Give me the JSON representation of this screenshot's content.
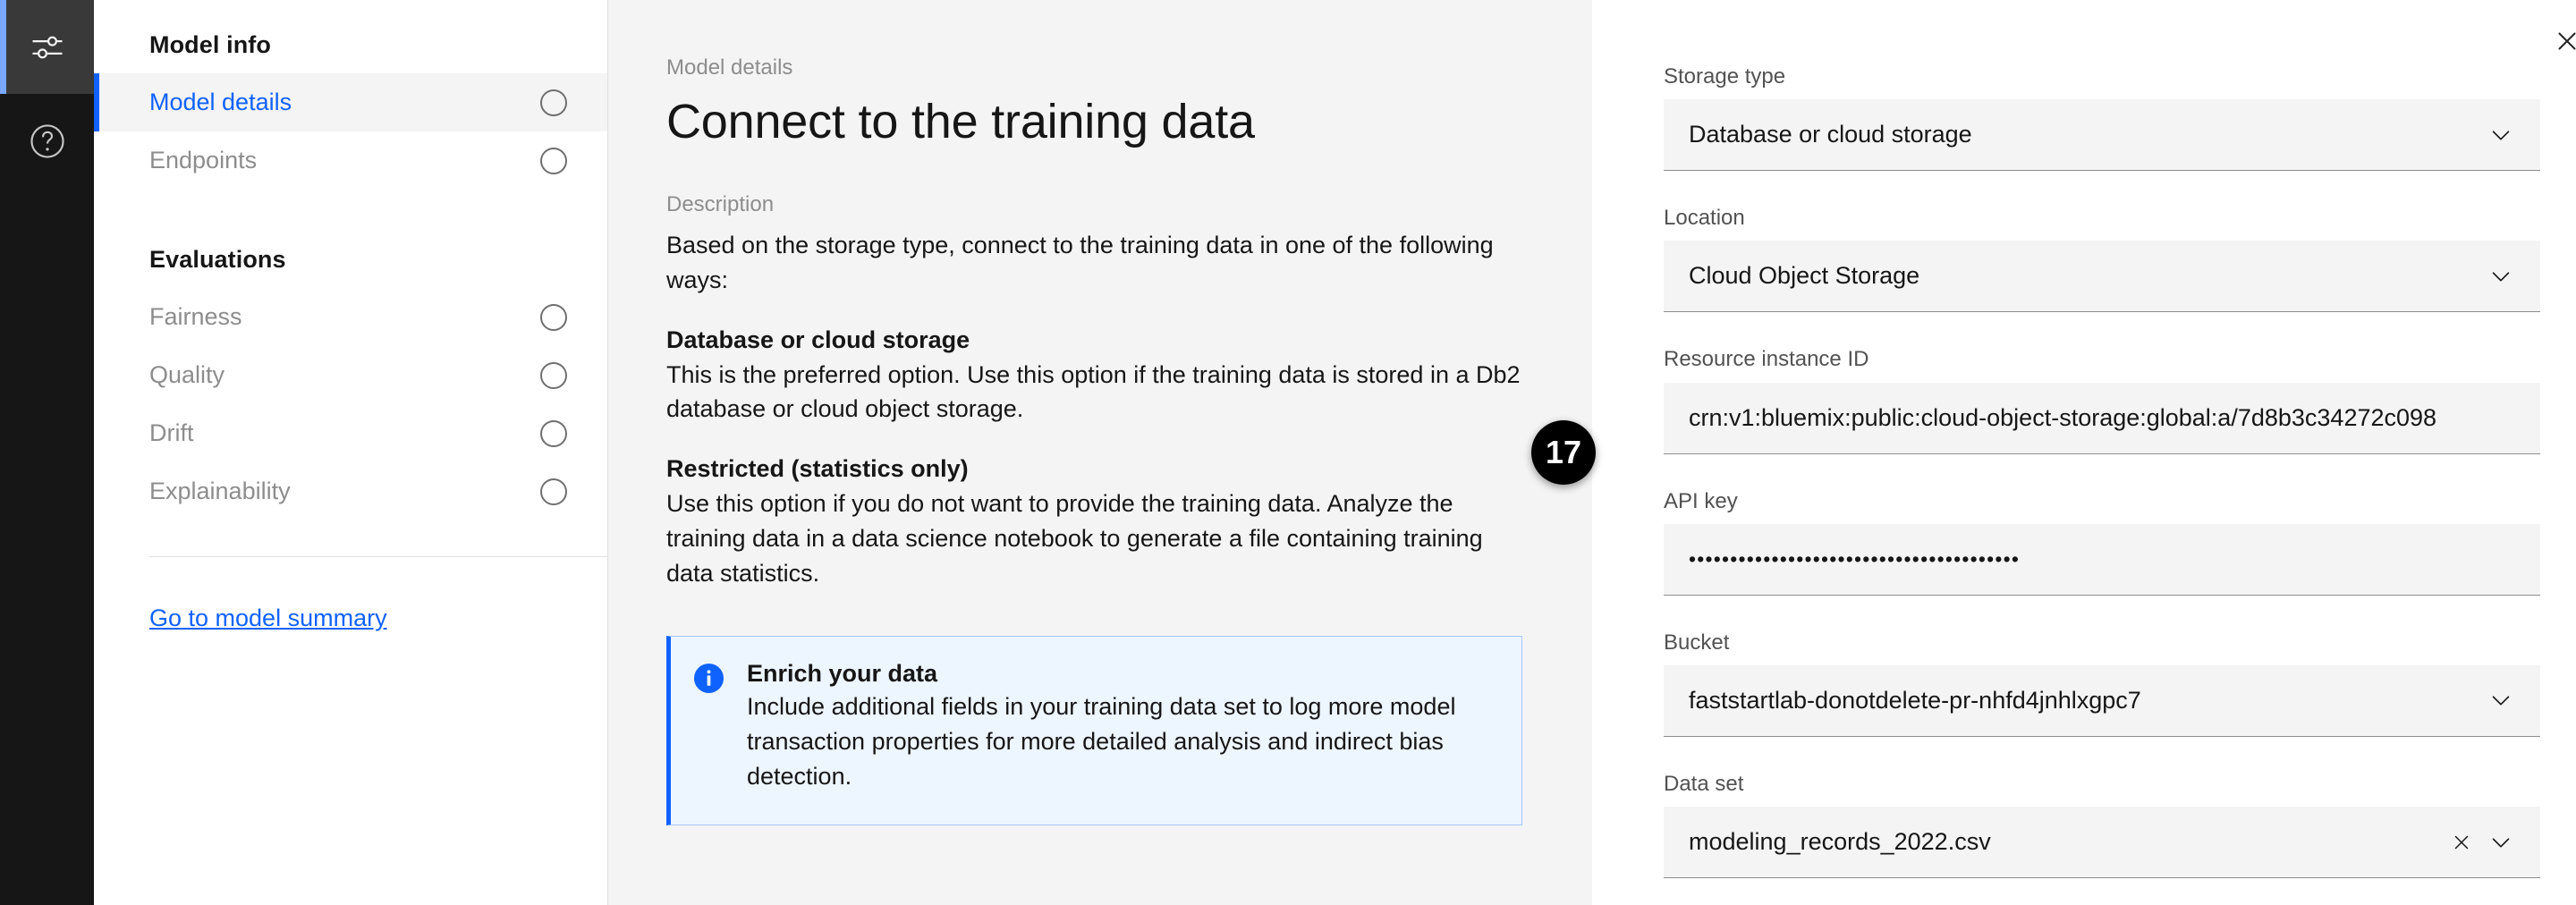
{
  "rail": {
    "items": [
      {
        "icon": "sliders-icon",
        "active": true
      },
      {
        "icon": "help-circle-icon",
        "active": false
      }
    ]
  },
  "sidebar": {
    "sections": [
      {
        "title": "Model info",
        "items": [
          {
            "label": "Model details",
            "active": true,
            "indicator": "circle"
          },
          {
            "label": "Endpoints",
            "active": false,
            "indicator": "circle"
          }
        ]
      },
      {
        "title": "Evaluations",
        "items": [
          {
            "label": "Fairness",
            "active": false,
            "indicator": "circle"
          },
          {
            "label": "Quality",
            "active": false,
            "indicator": "circle"
          },
          {
            "label": "Drift",
            "active": false,
            "indicator": "circle"
          },
          {
            "label": "Explainability",
            "active": false,
            "indicator": "circle"
          }
        ]
      }
    ],
    "summary_link": "Go to model summary"
  },
  "main": {
    "breadcrumb": "Model details",
    "title": "Connect to the training data",
    "description_label": "Description",
    "intro": "Based on the storage type, connect to the training data in one of the following ways:",
    "sections": [
      {
        "heading": "Database or cloud storage",
        "body": "This is the preferred option. Use this option if the training data is stored in a Db2 database or cloud object storage."
      },
      {
        "heading": "Restricted (statistics only)",
        "body": "Use this option if you do not want to provide the training data. Analyze the training data in a data science notebook to generate a file containing training data statistics."
      }
    ],
    "notification": {
      "icon": "info-filled-icon",
      "title": "Enrich your data",
      "body": "Include additional fields in your training data set to log more model transaction properties for more detailed analysis and indirect bias detection."
    }
  },
  "panel": {
    "close_icon": "close-icon",
    "fields": [
      {
        "label": "Storage type",
        "value": "Database or cloud storage",
        "type": "select",
        "has_clear": false,
        "has_refresh": false
      },
      {
        "label": "Location",
        "value": "Cloud Object Storage",
        "type": "select",
        "has_clear": false,
        "has_refresh": false
      },
      {
        "label": "Resource instance ID",
        "value": "crn:v1:bluemix:public:cloud-object-storage:global:a/7d8b3c34272c098",
        "type": "text",
        "has_clear": false,
        "has_refresh": false
      },
      {
        "label": "API key",
        "value": "••••••••••••••••••••••••••••••••••••••••",
        "type": "password",
        "has_clear": false,
        "has_refresh": false
      },
      {
        "label": "Bucket",
        "value": "faststartlab-donotdelete-pr-nhfd4jnhlxgpc7",
        "type": "select",
        "has_clear": false,
        "has_refresh": true
      },
      {
        "label": "Data set",
        "value": "modeling_records_2022.csv",
        "type": "select",
        "has_clear": true,
        "has_refresh": true
      }
    ]
  },
  "step_badge": {
    "number": "17"
  },
  "colors": {
    "accent": "#0f62fe",
    "rail_bg": "#161616",
    "rail_active_bg": "#393939",
    "rail_active_bar": "#78a9ff",
    "main_bg": "#f4f4f4",
    "field_bg": "#f4f4f4",
    "notif_bg": "#edf5ff",
    "notif_border": "#a6c8ff",
    "badge_bg": "#000000"
  }
}
